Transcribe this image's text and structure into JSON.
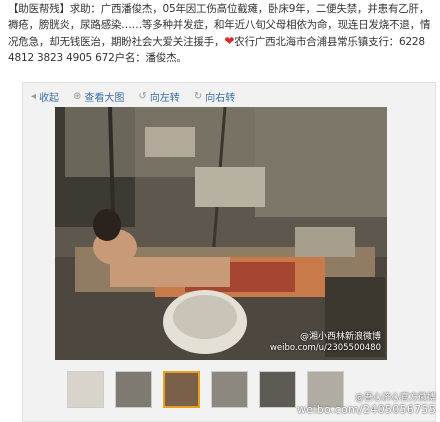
{
  "post": {
    "text": "【助医帮残】求助：广西潘俊杰，05年因工伤高位截瘫，卧床9年，二便失禁，并患有乙肝，褥疮，膀胱炎，尿路感染……等多种并发症，和年近八旬父母相依为命，现连日发烧不退，情况危急，却无钱医治，期盼社会大爱关注援手，",
    "heart": "❤",
    "bank_text": "农行广西北海市合浦县常乐镇支行：6228 4812 3823 4905 672户名：潘俊杰。"
  },
  "toolbar": {
    "collapse": "收起",
    "view_large": "查看大图",
    "rotate_left": "向左转",
    "rotate_right": "向右转"
  },
  "photo": {
    "watermark_line1": "@湘小西林新浪微博",
    "watermark_line2": "weibo.com/u/2305500480"
  },
  "thumbnails": [
    {
      "name": "thumb-1",
      "active": false
    },
    {
      "name": "thumb-2",
      "active": false
    },
    {
      "name": "thumb-3",
      "active": true
    },
    {
      "name": "thumb-4",
      "active": false
    },
    {
      "name": "thumb-5",
      "active": false
    },
    {
      "name": "thumb-6",
      "active": false
    }
  ],
  "bottom_watermark": {
    "line1": "@吾心济心官方微博",
    "line2": "weibo.com/2405056755"
  },
  "colors": {
    "link": "#3b6fa5",
    "heart": "#e0252b",
    "active_thumb_border": "#e7a21c"
  }
}
